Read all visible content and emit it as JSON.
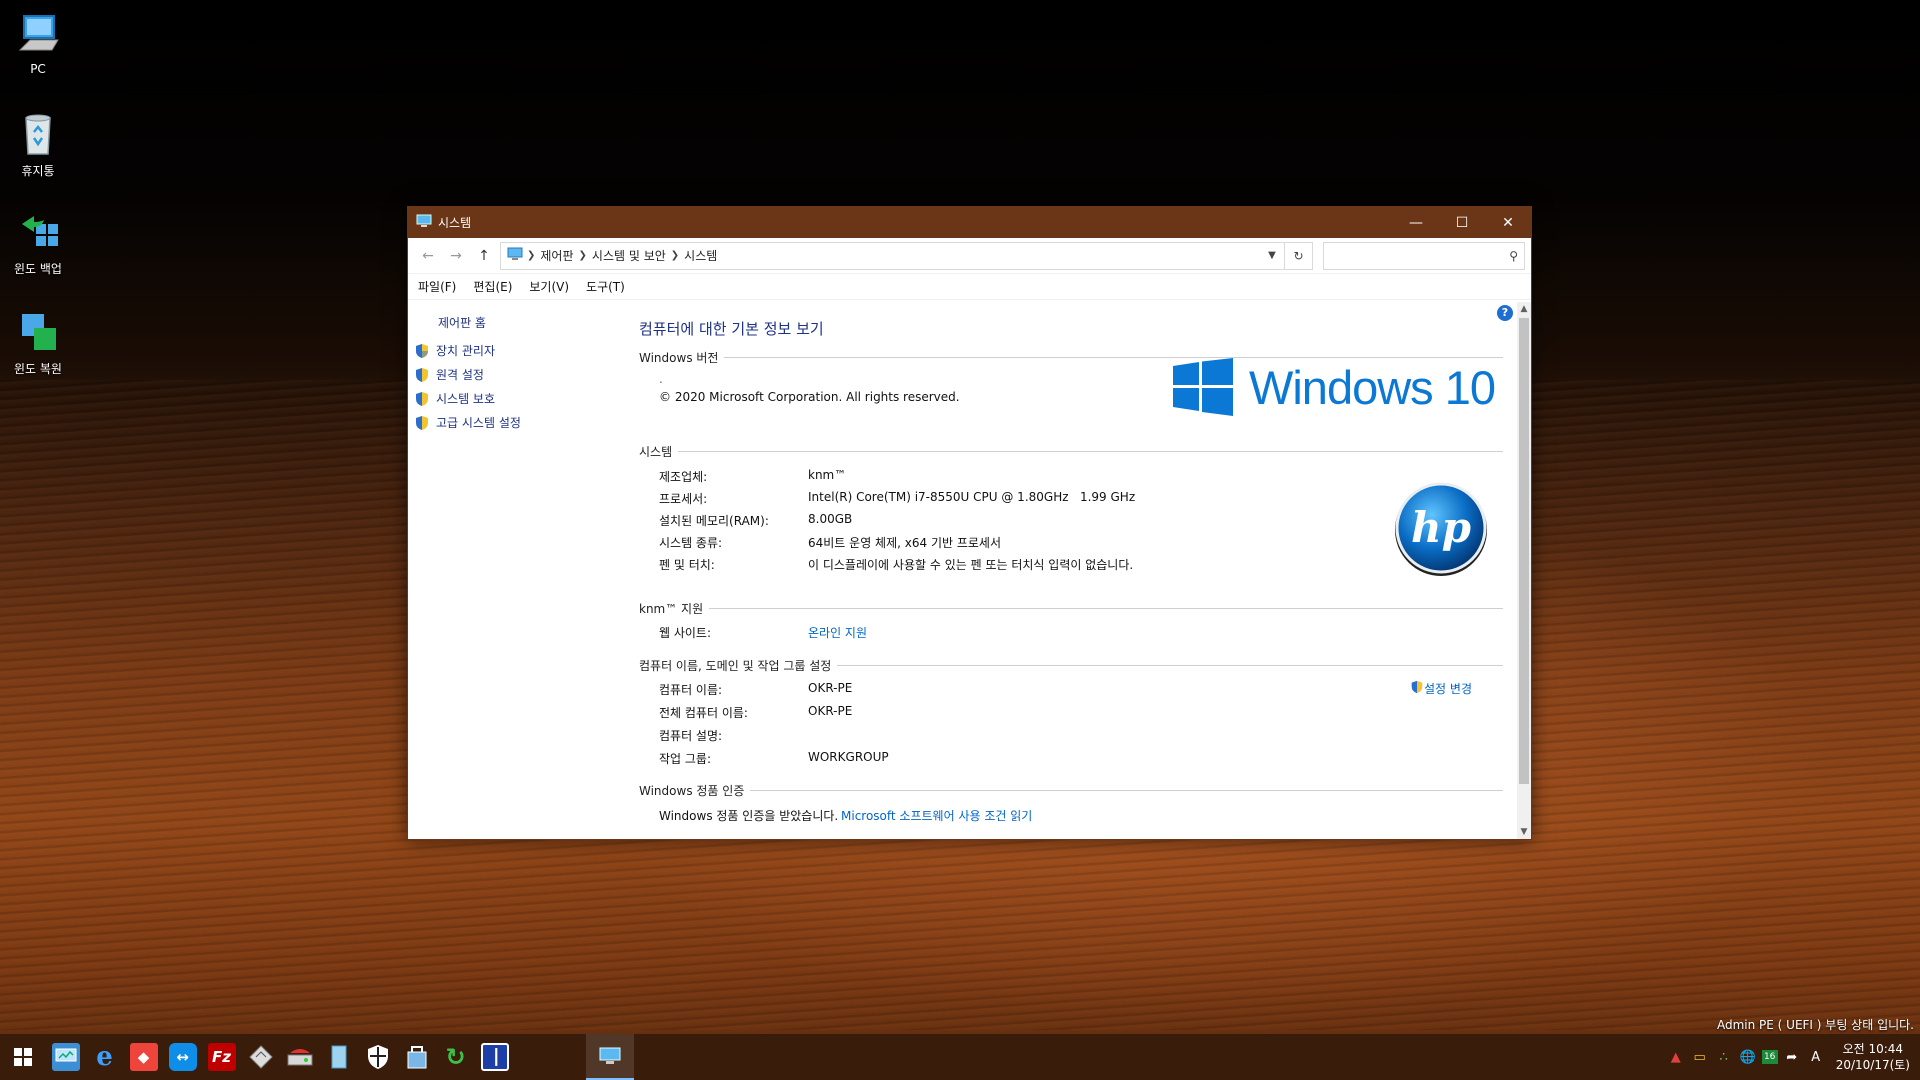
{
  "desktop": {
    "icons": [
      {
        "label": "PC",
        "icon": "computer-icon"
      },
      {
        "label": "휴지통",
        "icon": "recycle-bin-icon"
      },
      {
        "label": "윈도 백업",
        "icon": "backup-icon"
      },
      {
        "label": "윈도 복원",
        "icon": "restore-icon"
      }
    ],
    "pe_notice": "Admin PE ( UEFI ) 부팅 상태 입니다."
  },
  "window": {
    "title": "시스템",
    "breadcrumb": [
      "제어판",
      "시스템 및 보안",
      "시스템"
    ],
    "search_placeholder": "",
    "menu": [
      "파일(F)",
      "편집(E)",
      "보기(V)",
      "도구(T)"
    ],
    "left_pane": {
      "home": "제어판 홈",
      "links": [
        "장치 관리자",
        "원격 설정",
        "시스템 보호",
        "고급 시스템 설정"
      ]
    },
    "heading": "컴퓨터에 대한 기본 정보 보기",
    "windows_edition": {
      "section": "Windows 버전",
      "dot": ".",
      "copyright": "© 2020 Microsoft Corporation. All rights reserved.",
      "logo_text": "Windows 10"
    },
    "system": {
      "section": "시스템",
      "rows": [
        {
          "label": "제조업체:",
          "value": "knm™"
        },
        {
          "label": "프로세서:",
          "value": "Intel(R) Core(TM) i7-8550U CPU @ 1.80GHz   1.99 GHz"
        },
        {
          "label": "설치된 메모리(RAM):",
          "value": "8.00GB"
        },
        {
          "label": "시스템 종류:",
          "value": "64비트 운영 체제, x64 기반 프로세서"
        },
        {
          "label": "펜 및 터치:",
          "value": "이 디스플레이에 사용할 수 있는 펜 또는 터치식 입력이 없습니다."
        }
      ],
      "oem_logo": "hp"
    },
    "support": {
      "section": "knm™ 지원",
      "label": "웹 사이트:",
      "link": "온라인 지원"
    },
    "computer_name": {
      "section": "컴퓨터 이름, 도메인 및 작업 그룹 설정",
      "change_link": "설정 변경",
      "rows": [
        {
          "label": "컴퓨터 이름:",
          "value": "OKR-PE"
        },
        {
          "label": "전체 컴퓨터 이름:",
          "value": "OKR-PE"
        },
        {
          "label": "컴퓨터 설명:",
          "value": ""
        },
        {
          "label": "작업 그룹:",
          "value": "WORKGROUP"
        }
      ]
    },
    "activation": {
      "section": "Windows 정품 인증",
      "status": "Windows 정품 인증을 받았습니다.",
      "link": "Microsoft 소프트웨어 사용 조건 읽기"
    }
  },
  "taskbar": {
    "badge": "16",
    "ime": "A",
    "clock_time": "오전 10:44",
    "clock_date": "20/10/17(토)"
  },
  "colors": {
    "titlebar": "#6b3617",
    "taskbar": "#3a1c0b",
    "link": "#0066cc",
    "heading": "#1e3287",
    "windows_blue": "#0a78d4"
  }
}
